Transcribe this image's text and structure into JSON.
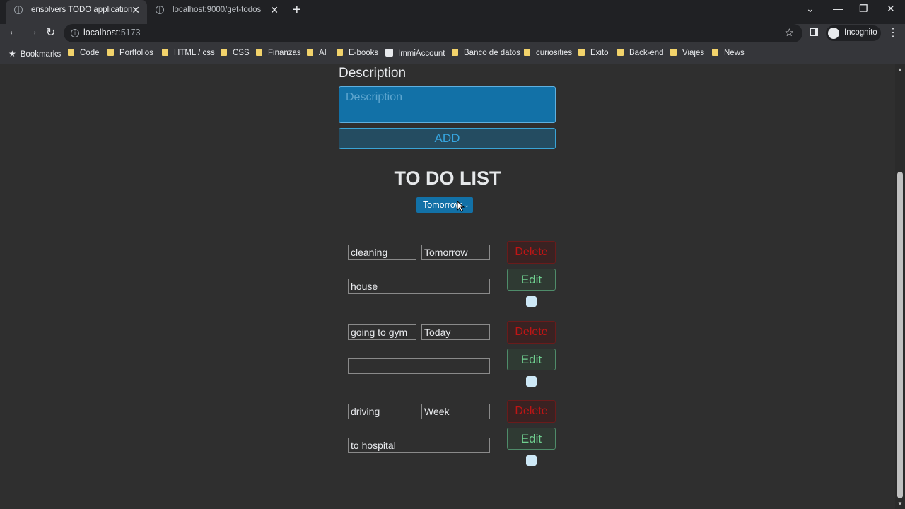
{
  "browser": {
    "tabs": [
      {
        "label": "ensolvers TODO application",
        "active": true
      },
      {
        "label": "localhost:9000/get-todos",
        "active": false
      }
    ],
    "url_host": "localhost",
    "url_port": ":5173",
    "profile_label": "Incognito",
    "bookmarks": [
      "Bookmarks",
      "Code",
      "Portfolios",
      "HTML / css",
      "CSS",
      "Finanzas",
      "AI",
      "E-books",
      "ImmiAccount",
      "Banco de datos",
      "curiosities",
      "Exito",
      "Back-end",
      "Viajes",
      "News"
    ]
  },
  "form": {
    "description_label": "Description",
    "description_placeholder": "Description",
    "add_label": "ADD"
  },
  "list": {
    "title": "TO DO LIST",
    "filter_selected": "Tomorrow",
    "items": [
      {
        "title": "cleaning",
        "when": "Tomorrow",
        "body": "house",
        "delete_label": "Delete",
        "edit_label": "Edit",
        "done": false
      },
      {
        "title": "going to gym",
        "when": "Today",
        "body": "",
        "delete_label": "Delete",
        "edit_label": "Edit",
        "done": false
      },
      {
        "title": "driving",
        "when": "Week",
        "body": "to hospital",
        "delete_label": "Delete",
        "edit_label": "Edit",
        "done": false
      }
    ]
  },
  "colors": {
    "accent": "#1271a7",
    "delete": "#c01515",
    "edit": "#6fcf8f",
    "background": "#2f2f2f"
  }
}
